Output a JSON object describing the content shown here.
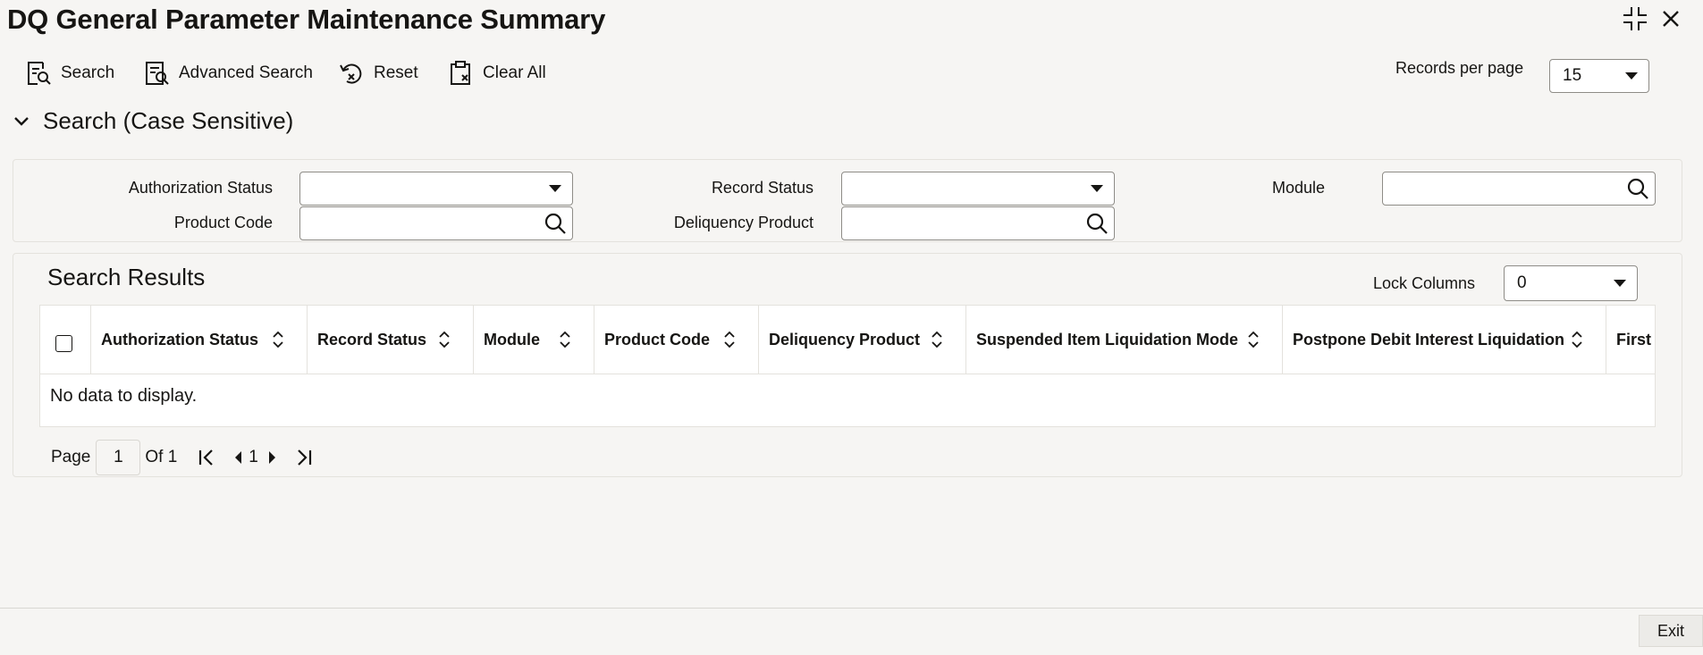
{
  "window": {
    "title": "DQ General Parameter Maintenance Summary",
    "controls": [
      "collapse-icon",
      "close-icon"
    ]
  },
  "toolbar": {
    "search_label": "Search",
    "advanced_search_label": "Advanced Search",
    "reset_label": "Reset",
    "clear_all_label": "Clear All",
    "records_per_page_label": "Records per page",
    "records_per_page_value": "15"
  },
  "search_section": {
    "title": "Search (Case Sensitive)",
    "fields": {
      "authorization_status": {
        "label": "Authorization Status",
        "value": ""
      },
      "record_status": {
        "label": "Record Status",
        "value": ""
      },
      "module": {
        "label": "Module",
        "value": ""
      },
      "product_code": {
        "label": "Product Code",
        "value": ""
      },
      "deliquency_product": {
        "label": "Deliquency Product",
        "value": ""
      }
    }
  },
  "results": {
    "title": "Search Results",
    "lock_columns_label": "Lock Columns",
    "lock_columns_value": "0",
    "columns": [
      "Authorization Status",
      "Record Status",
      "Module",
      "Product Code",
      "Deliquency Product",
      "Suspended Item Liquidation Mode",
      "Postpone Debit Interest Liquidation",
      "First L"
    ],
    "empty_message": "No data to display."
  },
  "pagination": {
    "page_label": "Page",
    "current_page": "1",
    "of_label": "Of 1",
    "page_number": "1"
  },
  "footer": {
    "exit_label": "Exit"
  }
}
